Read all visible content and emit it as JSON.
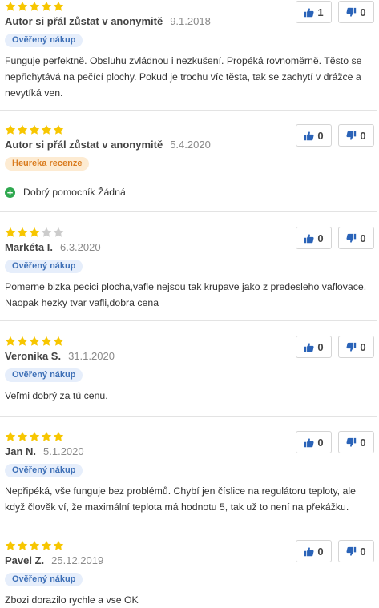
{
  "colors": {
    "star_filled": "#f7c600",
    "star_empty": "#cccccc",
    "thumb": "#2a63b8",
    "pro_icon": "#2fa84f"
  },
  "reviews": [
    {
      "rating": 5,
      "author": "Autor si přál zůstat v anonymitě",
      "date": "9.1.2018",
      "badge": "Ověřený nákup",
      "badge_type": "verified",
      "text": "Funguje perfektně. Obsluhu zvládnou i nezkušení. Propéká rovnoměrně. Těsto se nepřichytává na pečící plochy. Pokud je trochu víc těsta, tak se zachytí v drážce a nevytíká ven.",
      "likes": "1",
      "dislikes": "0"
    },
    {
      "rating": 5,
      "author": "Autor si přál zůstat v anonymitě",
      "date": "5.4.2020",
      "badge": "Heureka recenze",
      "badge_type": "heureka",
      "pro": "Dobrý pomocník Žádná",
      "pro_icon": "plus-circle-icon",
      "likes": "0",
      "dislikes": "0"
    },
    {
      "rating": 3,
      "author": "Markéta I.",
      "date": "6.3.2020",
      "badge": "Ověřený nákup",
      "badge_type": "verified",
      "text": "Pomerne bizka pecici plocha,vafle nejsou tak krupave jako z predesleho vaflovace. Naopak hezky tvar vafli,dobra cena",
      "likes": "0",
      "dislikes": "0"
    },
    {
      "rating": 5,
      "author": "Veronika S.",
      "date": "31.1.2020",
      "badge": "Ověřený nákup",
      "badge_type": "verified",
      "text": "Veľmi dobrý za tú cenu.",
      "likes": "0",
      "dislikes": "0"
    },
    {
      "rating": 5,
      "author": "Jan N.",
      "date": "5.1.2020",
      "badge": "Ověřený nákup",
      "badge_type": "verified",
      "text": "Nepřipéká, vše funguje bez problémů. Chybí jen číslice na regulátoru teploty, ale když člověk ví, že maximální teplota má hodnotu 5, tak už to není na překážku.",
      "likes": "0",
      "dislikes": "0"
    },
    {
      "rating": 5,
      "author": "Pavel Z.",
      "date": "25.12.2019",
      "badge": "Ověřený nákup",
      "badge_type": "verified",
      "text": "Zbozi dorazilo rychle a vse OK",
      "likes": "0",
      "dislikes": "0"
    }
  ]
}
